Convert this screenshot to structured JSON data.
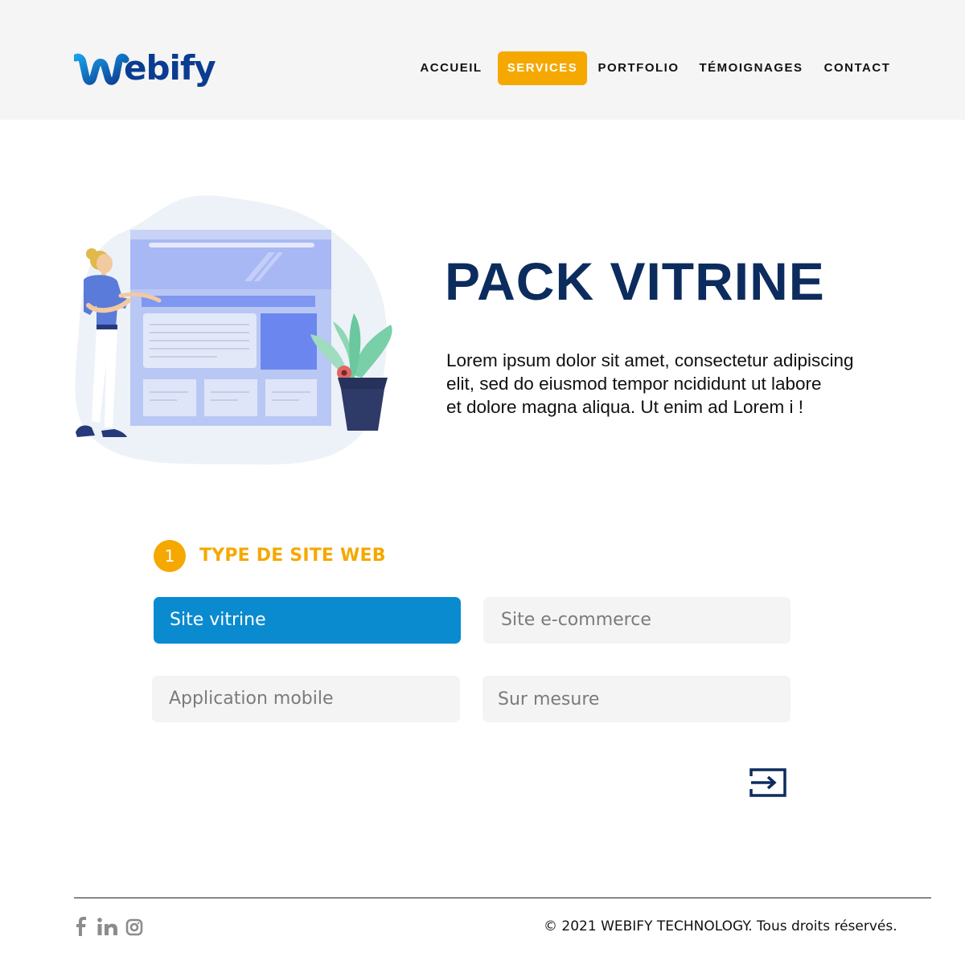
{
  "header": {
    "logo_text": "Webify",
    "nav": [
      {
        "label": "ACCUEIL",
        "active": false
      },
      {
        "label": "SERVICES",
        "active": true
      },
      {
        "label": "PORTFOLIO",
        "active": false
      },
      {
        "label": "TÉMOIGNAGES",
        "active": false
      },
      {
        "label": "CONTACT",
        "active": false
      }
    ]
  },
  "hero": {
    "title": "PACK VITRINE",
    "description_lines": [
      "Lorem ipsum dolor sit amet, consectetur adipiscing",
      "elit, sed do eiusmod tempor ncididunt ut labore",
      "et dolore magna aliqua. Ut enim ad Lorem i !"
    ],
    "illustration": "person-presenting-website-with-plant"
  },
  "step": {
    "number": "1",
    "title": "TYPE DE SITE WEB",
    "options": [
      {
        "label": "Site vitrine",
        "selected": true
      },
      {
        "label": "Site e-commerce",
        "selected": false
      },
      {
        "label": "Application mobile",
        "selected": false
      },
      {
        "label": "Sur mesure",
        "selected": false
      }
    ],
    "next_icon": "enter-arrow-icon"
  },
  "footer": {
    "social_icons": [
      "facebook-icon",
      "linkedin-icon",
      "instagram-icon"
    ],
    "copyright": "© 2021 WEBIFY TECHNOLOGY. Tous droits réservés."
  },
  "colors": {
    "accent": "#f5a800",
    "primary_blue": "#0a8bcf",
    "navy": "#0d2c5e",
    "header_bg": "#f5f5f5",
    "option_bg": "#f4f4f4"
  }
}
